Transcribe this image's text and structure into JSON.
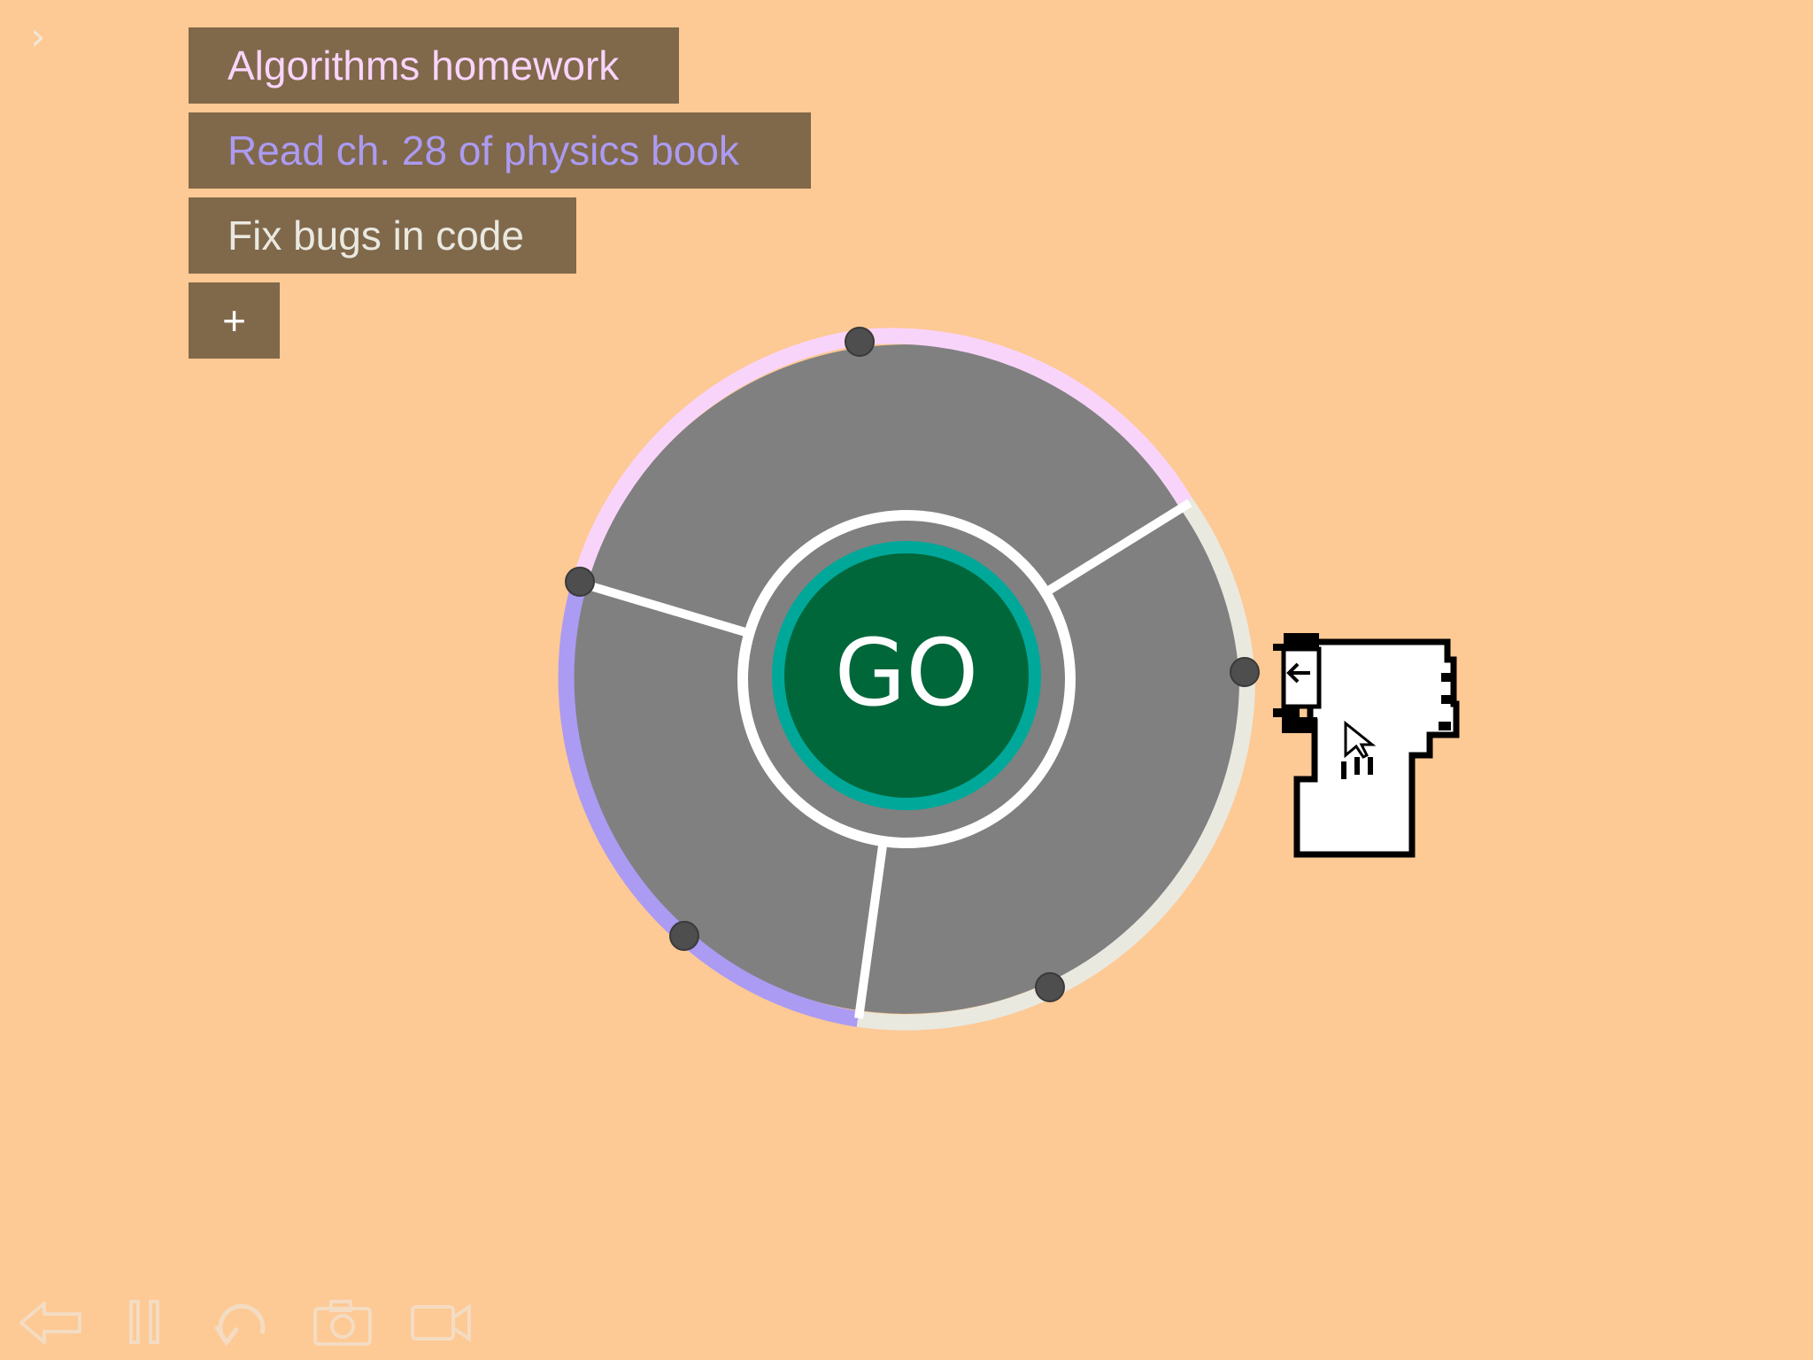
{
  "tasks": [
    {
      "label": "Algorithms homework",
      "color": "#f9d4fa"
    },
    {
      "label": "Read ch. 28 of physics book",
      "color": "#ab9bf2"
    },
    {
      "label": "Fix bugs in code",
      "color": "#e9e9e0"
    }
  ],
  "add_task": {
    "label": "+"
  },
  "wheel": {
    "go_label": "GO",
    "ring_color": "#808080",
    "go_fill": "#00673a",
    "go_ring": "#00a89a"
  },
  "colors": {
    "background": "#fdc995",
    "task_button": "#80684b"
  },
  "icons": {
    "corner": "chevron-right-icon",
    "toolbar": [
      "back-arrow-icon",
      "pause-icon",
      "undo-icon",
      "camera-icon",
      "video-camera-icon"
    ],
    "cursor": "hand-pointer-icon"
  }
}
